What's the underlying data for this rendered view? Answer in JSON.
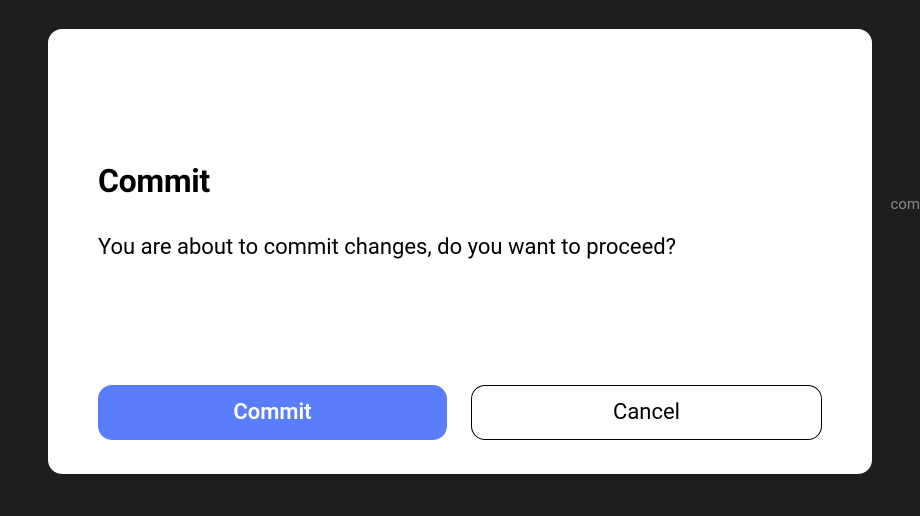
{
  "background": {
    "hint_text": "com"
  },
  "modal": {
    "title": "Commit",
    "message": "You are about to commit changes, do you want to proceed?",
    "buttons": {
      "primary_label": "Commit",
      "secondary_label": "Cancel"
    }
  }
}
